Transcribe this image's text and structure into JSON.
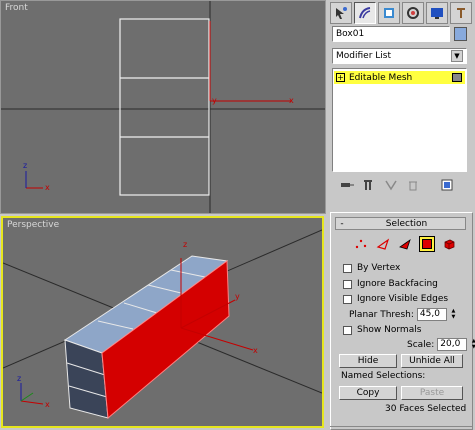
{
  "viewports": {
    "front": {
      "label": "Front",
      "axis_x": "x",
      "axis_y": "y",
      "axis_z": "z"
    },
    "perspective": {
      "label": "Perspective",
      "axis_x": "x",
      "axis_y": "y",
      "axis_z": "z"
    }
  },
  "command_panel": {
    "tabs": [
      {
        "icon": "create-icon"
      },
      {
        "icon": "modify-icon"
      },
      {
        "icon": "hierarchy-icon"
      },
      {
        "icon": "motion-icon"
      },
      {
        "icon": "display-icon"
      },
      {
        "icon": "utilities-icon"
      }
    ],
    "object_name": "Box01",
    "object_color": "#88aadd",
    "modifier_list": "Modifier List",
    "stack": [
      {
        "label": "Editable Mesh",
        "prefix": "+"
      }
    ],
    "stack_tools": [
      {
        "icon": "pin-stack-icon"
      },
      {
        "icon": "show-end-result-icon"
      },
      {
        "icon": "make-unique-icon"
      },
      {
        "icon": "remove-modifier-icon"
      },
      {
        "icon": "configure-modifier-sets-icon"
      }
    ]
  },
  "selection": {
    "title": "Selection",
    "collapse": "-",
    "sublevels": [
      {
        "name": "vertex",
        "icon": "vertex-icon"
      },
      {
        "name": "edge",
        "icon": "edge-icon"
      },
      {
        "name": "face",
        "icon": "face-icon"
      },
      {
        "name": "polygon",
        "icon": "polygon-icon",
        "active": true
      },
      {
        "name": "element",
        "icon": "element-icon"
      }
    ],
    "by_vertex": "By Vertex",
    "ignore_backfacing": "Ignore Backfacing",
    "ignore_visible_edges": "Ignore Visible Edges",
    "planar_thresh_label": "Planar Thresh:",
    "planar_thresh_value": "45,0",
    "show_normals": "Show Normals",
    "scale_label": "Scale:",
    "scale_value": "20,0",
    "hide": "Hide",
    "unhide_all": "Unhide All",
    "named_selections": "Named Selections:",
    "copy": "Copy",
    "paste": "Paste",
    "status": "30 Faces Selected"
  },
  "colors": {
    "viewport_bg": "#6e6e6e",
    "active_border": "#e6e61e",
    "selected_face": "#d40000",
    "box_face": "#8ea6c8",
    "stack_highlight": "#ffff40"
  }
}
